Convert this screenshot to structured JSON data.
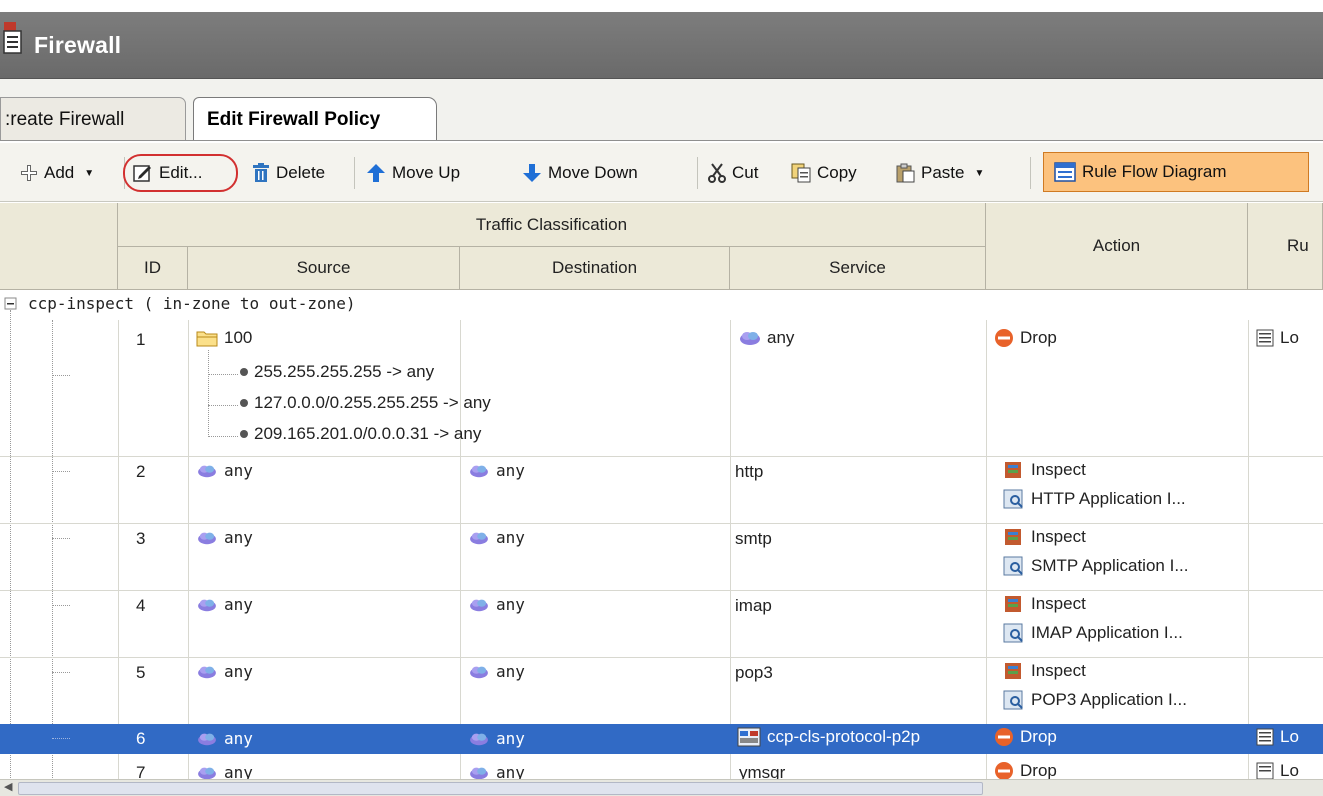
{
  "window": {
    "title": "Firewall",
    "icon": "firewall-document-icon"
  },
  "tabs": [
    {
      "label": "Create Firewall",
      "display": ":reate Firewall",
      "active": false
    },
    {
      "label": "Edit Firewall Policy",
      "active": true
    }
  ],
  "toolbar": {
    "add_label": "Add",
    "edit_label": "Edit...",
    "delete_label": "Delete",
    "move_up_label": "Move Up",
    "move_down_label": "Move Down",
    "cut_label": "Cut",
    "copy_label": "Copy",
    "paste_label": "Paste",
    "rule_flow_label": "Rule Flow Diagram"
  },
  "grid": {
    "group_header": "Traffic Classification",
    "columns": {
      "id": "ID",
      "source": "Source",
      "destination": "Destination",
      "service": "Service",
      "action": "Action",
      "rule_options": "Ru"
    },
    "zone_pair": "ccp-inspect ( in-zone to out-zone)",
    "rows": [
      {
        "id": "1",
        "source": "100",
        "destination": "",
        "service": "any",
        "action": "Drop",
        "option": "Lo",
        "acl_entries": [
          "255.255.255.255 -> any",
          "127.0.0.0/0.255.255.255 -> any",
          "209.165.201.0/0.0.0.31 -> any"
        ]
      },
      {
        "id": "2",
        "source": "any",
        "destination": "any",
        "service": "http",
        "action": "Inspect",
        "action_detail": "HTTP Application I..."
      },
      {
        "id": "3",
        "source": "any",
        "destination": "any",
        "service": "smtp",
        "action": "Inspect",
        "action_detail": "SMTP Application I..."
      },
      {
        "id": "4",
        "source": "any",
        "destination": "any",
        "service": "imap",
        "action": "Inspect",
        "action_detail": "IMAP Application I..."
      },
      {
        "id": "5",
        "source": "any",
        "destination": "any",
        "service": "pop3",
        "action": "Inspect",
        "action_detail": "POP3 Application I..."
      },
      {
        "id": "6",
        "source": "any",
        "destination": "any",
        "service": "ccp-cls-protocol-p2p",
        "action": "Drop",
        "option": "Lo",
        "selected": true
      },
      {
        "id": "7",
        "source": "any",
        "destination": "any",
        "service": "ymsgr",
        "action": "Drop",
        "option": "Lo"
      }
    ]
  },
  "colors": {
    "selection": "#316ac5",
    "title_bar": "#737373",
    "header_bg": "#ece9d8",
    "highlight_ring": "#d23030",
    "flow_button": "#fcc27e"
  }
}
